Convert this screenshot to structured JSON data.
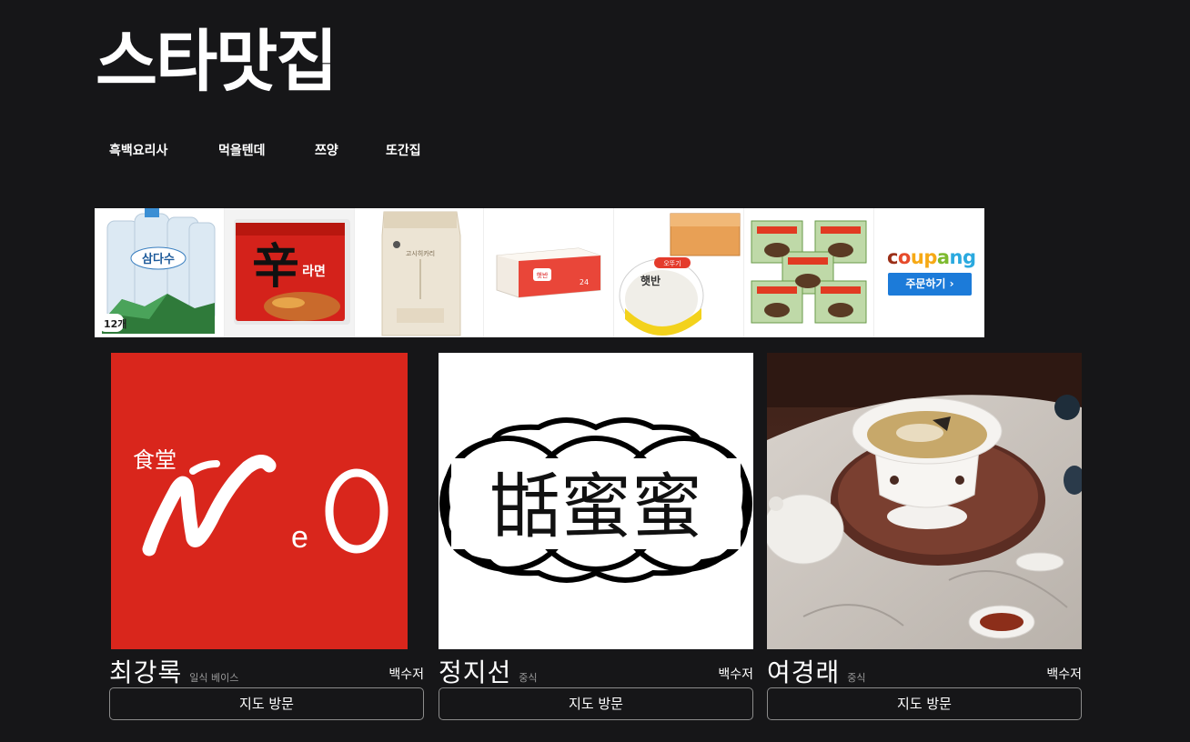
{
  "site": {
    "title": "스타맛집"
  },
  "nav": {
    "items": [
      {
        "label": "흑백요리사"
      },
      {
        "label": "먹을텐데"
      },
      {
        "label": "쯔양"
      },
      {
        "label": "또간집"
      }
    ]
  },
  "ad": {
    "products": [
      {
        "name": "water-bottles",
        "badge": "12개"
      },
      {
        "name": "ramen-pack",
        "label": "辛라면"
      },
      {
        "name": "rice-bag"
      },
      {
        "name": "rice-box"
      },
      {
        "name": "instant-rice",
        "label": "햇반"
      },
      {
        "name": "jjapagetti-packs"
      }
    ],
    "coupang": {
      "logo": [
        "c",
        "o",
        "u",
        "p",
        "a",
        "ng"
      ],
      "order_label": "주문하기 ›"
    }
  },
  "restaurants": [
    {
      "name": "최강록",
      "category": "일식 베이스",
      "chef": "백수저",
      "map_label": "지도 방문",
      "logo": {
        "top_text": "食堂",
        "main_text": "NeO",
        "bg": "#d9261c"
      }
    },
    {
      "name": "정지선",
      "category": "중식",
      "chef": "백수저",
      "map_label": "지도 방문",
      "logo": {
        "main_text": "甛蜜蜜",
        "bg": "#ffffff"
      }
    },
    {
      "name": "여경래",
      "category": "중식",
      "chef": "백수저",
      "map_label": "지도 방문"
    }
  ],
  "colors": {
    "background": "#161618",
    "neo_red": "#d9261c",
    "coupang_blue": "#1c7bd9"
  }
}
